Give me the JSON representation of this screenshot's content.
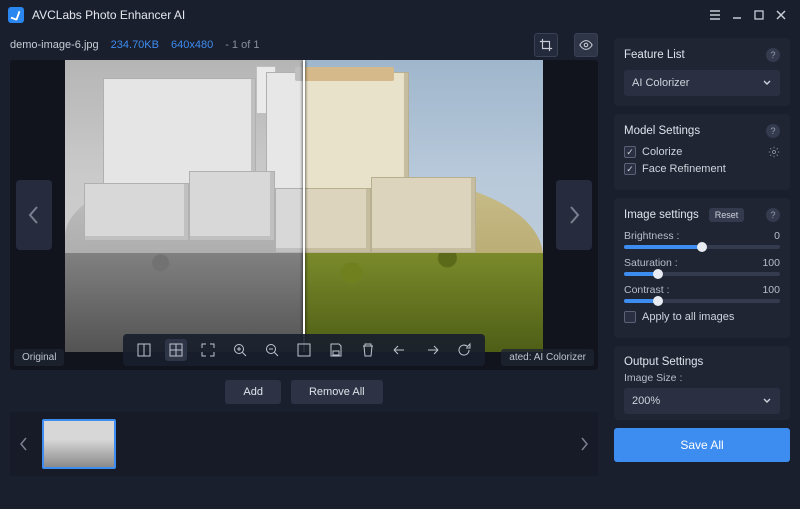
{
  "app": {
    "title": "AVCLabs Photo Enhancer AI"
  },
  "file": {
    "name": "demo-image-6.jpg",
    "size": "234.70KB",
    "dimensions": "640x480",
    "index": "- 1 of 1"
  },
  "viewer": {
    "original_label": "Original",
    "output_label": "ated: AI Colorizer"
  },
  "actions": {
    "add": "Add",
    "remove_all": "Remove All"
  },
  "side": {
    "feature": {
      "title": "Feature List",
      "selected": "AI Colorizer"
    },
    "model": {
      "title": "Model Settings",
      "colorize": "Colorize",
      "face": "Face Refinement",
      "colorize_checked": true,
      "face_checked": true
    },
    "image": {
      "title": "Image settings",
      "reset": "Reset",
      "brightness_label": "Brightness :",
      "brightness_value": "0",
      "brightness_pct": 50,
      "saturation_label": "Saturation :",
      "saturation_value": "100",
      "saturation_pct": 22,
      "contrast_label": "Contrast :",
      "contrast_value": "100",
      "contrast_pct": 22,
      "apply_all": "Apply to all images",
      "apply_all_checked": false
    },
    "output": {
      "title": "Output Settings",
      "size_label": "Image Size :",
      "size_value": "200%"
    },
    "save": "Save All"
  }
}
